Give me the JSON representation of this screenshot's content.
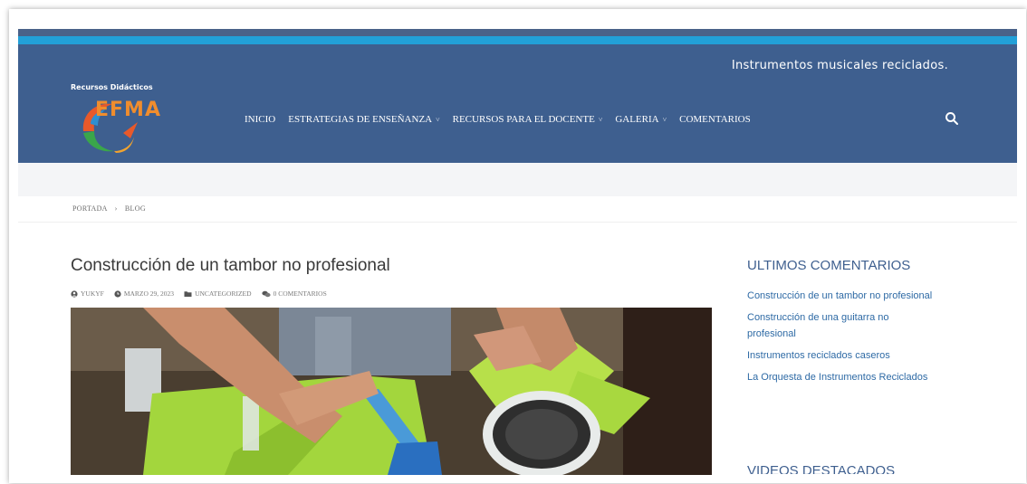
{
  "header": {
    "tagline": "Instrumentos musicales reciclados.",
    "brand_small": "Recursos Didácticos",
    "logo_text": "EFMA",
    "nav": [
      {
        "label": "INICIO",
        "dropdown": false
      },
      {
        "label": "ESTRATEGIAS DE ENSEÑANZA",
        "dropdown": true
      },
      {
        "label": "RECURSOS PARA EL DOCENTE",
        "dropdown": true
      },
      {
        "label": "GALERIA",
        "dropdown": true
      },
      {
        "label": "COMENTARIOS",
        "dropdown": false
      }
    ]
  },
  "breadcrumb": {
    "home": "PORTADA",
    "separator": "›",
    "current": "BLOG"
  },
  "post": {
    "title": "Construcción de un tambor no profesional",
    "author": "YUKYF",
    "date": "MARZO 29, 2023",
    "category": "UNCATEGORIZED",
    "comments": "0 COMENTARIOS"
  },
  "sidebar": {
    "heading": "ULTIMOS COMENTARIOS",
    "links": [
      "Construcción de un tambor no profesional",
      "Construcción de una guitarra no profesional",
      "Instrumentos reciclados caseros",
      "La Orquesta de Instrumentos Reciclados"
    ],
    "next_heading": "VIDEOS DESTACADOS"
  },
  "colors": {
    "header_bg": "#3e5f8f",
    "accent_teal": "#22a0d8",
    "link": "#2e6aa5"
  }
}
